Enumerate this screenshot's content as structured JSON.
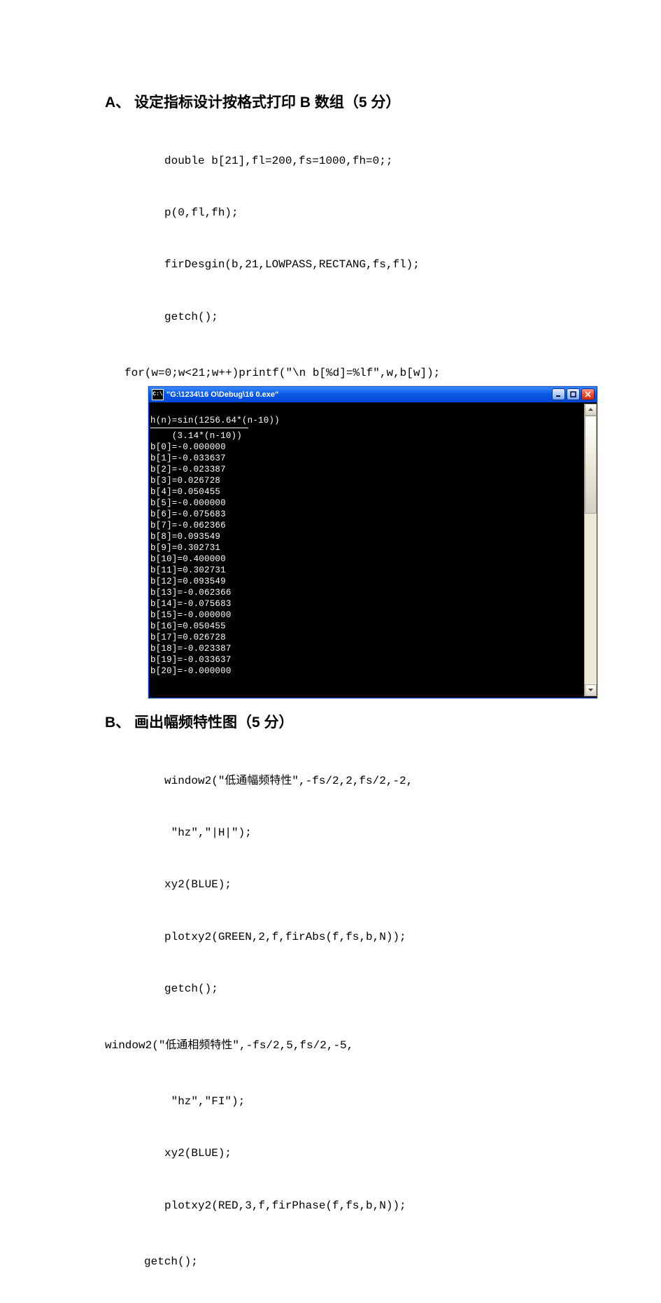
{
  "sectionA": {
    "heading": "A、 设定指标设计按格式打印 B 数组（5 分）",
    "code": [
      "double b[21],fl=200,fs=1000,fh=0;;",
      "p(0,fl,fh);",
      "firDesgin(b,21,LOWPASS,RECTANG,fs,fl);",
      "getch();"
    ],
    "code_tail": "for(w=0;w<21;w++)printf(\"\\n b[%d]=%lf\",w,b[w]);"
  },
  "console": {
    "title": "\"G:\\1234\\16 O\\Debug\\16 0.exe\"",
    "cmd_icon_text": "C:\\",
    "line_top": "h(n)=sin(1256.64*(n-10))",
    "line_under": "    (3.14*(n-10))",
    "b_values": [
      "b[0]=-0.000000",
      "b[1]=-0.033637",
      "b[2]=-0.023387",
      "b[3]=0.026728",
      "b[4]=0.050455",
      "b[5]=-0.000000",
      "b[6]=-0.075683",
      "b[7]=-0.062366",
      "b[8]=0.093549",
      "b[9]=0.302731",
      "b[10]=0.400000",
      "b[11]=0.302731",
      "b[12]=0.093549",
      "b[13]=-0.062366",
      "b[14]=-0.075683",
      "b[15]=-0.000000",
      "b[16]=0.050455",
      "b[17]=0.026728",
      "b[18]=-0.023387",
      "b[19]=-0.033637",
      "b[20]=-0.000000"
    ]
  },
  "sectionB": {
    "heading": "B、 画出幅频特性图（5 分）",
    "code1": [
      "window2(\"低通幅频特性\",-fs/2,2,fs/2,-2,",
      " \"hz\",\"|H|\");",
      "xy2(BLUE);",
      "plotxy2(GREEN,2,f,firAbs(f,fs,b,N));",
      "getch();"
    ],
    "code_mid": "window2(\"低通相频特性\",-fs/2,5,fs/2,-5,",
    "code2": [
      " \"hz\",\"FI\");",
      "xy2(BLUE);",
      "plotxy2(RED,3,f,firPhase(f,fs,b,N));"
    ],
    "code_tail": "getch();"
  }
}
